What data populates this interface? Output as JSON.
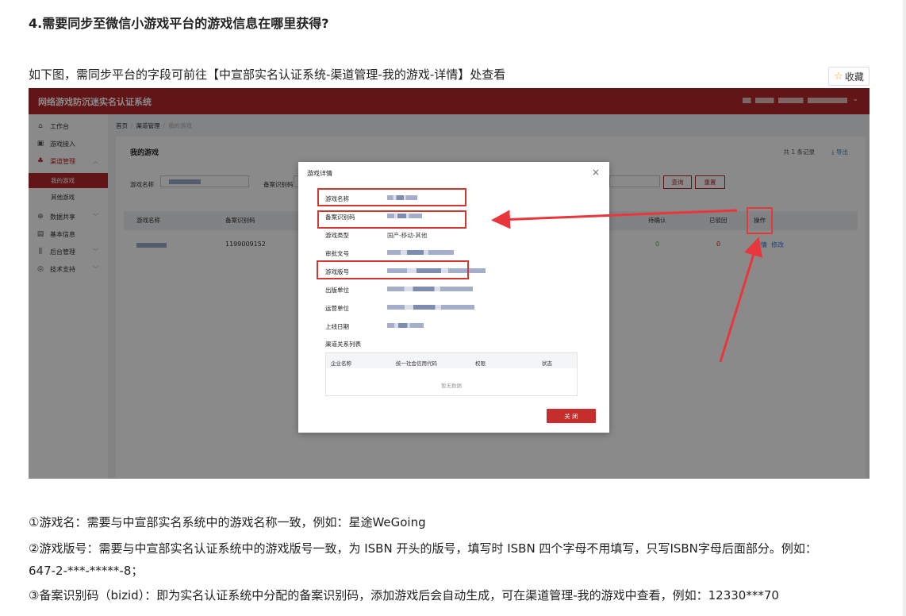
{
  "article": {
    "question_title": "4.需要同步至微信小游戏平台的游戏信息在哪里获得?",
    "intro": "如下图，需同步平台的字段可前往【中宣部实名认证系统-渠道管理-我的游戏-详情】处查看",
    "favorite_label": "收藏",
    "notes": [
      "①游戏名：需要与中宣部实名系统中的游戏名称一致，例如：星途WeGoing",
      "②游戏版号：需要与中宣部实名认证系统中的游戏版号一致，为 ISBN 开头的版号，填写时 ISBN 四个字母不用填写，只写ISBN字母后面部分。例如：",
      "647-2-***-*****-8；",
      "③备案识别码（bizid）：即为实名认证系统中分配的备案识别码，添加游戏后会自动生成，可在渠道管理-我的游戏中查看，例如：12330***70"
    ]
  },
  "system": {
    "app_title": "网络游戏防沉迷实名认证系统",
    "sidebar": {
      "items": [
        {
          "label": "工作台",
          "icon": "home-icon"
        },
        {
          "label": "游戏接入",
          "icon": "gamepad-icon"
        },
        {
          "label": "渠道管理",
          "icon": "channel-icon"
        },
        {
          "label": "数据共享",
          "icon": "share-icon"
        },
        {
          "label": "基本信息",
          "icon": "info-card-icon"
        },
        {
          "label": "后台管理",
          "icon": "admin-icon"
        },
        {
          "label": "技术支持",
          "icon": "support-icon"
        }
      ],
      "sub_items": [
        "我的游戏",
        "其他游戏"
      ]
    },
    "breadcrumb": [
      "首页",
      "渠道管理",
      "我的游戏"
    ],
    "page_heading": "我的游戏",
    "record_count": "共 1 条记录",
    "export_label": "导出",
    "filters": {
      "game_name_label": "游戏名称",
      "record_code_label": "备案识别码",
      "search_label": "查询",
      "reset_label": "重置"
    },
    "table": {
      "headers": [
        "游戏名称",
        "备案识别码",
        "待确认",
        "已驳回",
        "操作"
      ],
      "row": {
        "record_code": "1199009152",
        "pending": "0",
        "rejected": "0",
        "action_detail": "详情",
        "action_edit": "修改"
      }
    },
    "modal": {
      "title": "游戏详情",
      "close_x": "×",
      "fields": [
        {
          "label": "游戏名称",
          "value": ""
        },
        {
          "label": "备案识别码",
          "value": ""
        },
        {
          "label": "游戏类型",
          "value": "国产-移动-其他"
        },
        {
          "label": "审批文号",
          "value": ""
        },
        {
          "label": "游戏版号",
          "value": ""
        },
        {
          "label": "出版单位",
          "value": ""
        },
        {
          "label": "运营单位",
          "value": ""
        },
        {
          "label": "上线日期",
          "value": ""
        }
      ],
      "relation_title": "渠道关系列表",
      "relation_headers": [
        "企业名称",
        "统一社会信用代码",
        "权限",
        "状态"
      ],
      "empty_text": "暂无数据",
      "close_button": "关 闭"
    }
  },
  "colors": {
    "brand_red": "#b6282b",
    "highlight_red": "#e53935",
    "link_blue": "#3a7bd5"
  }
}
